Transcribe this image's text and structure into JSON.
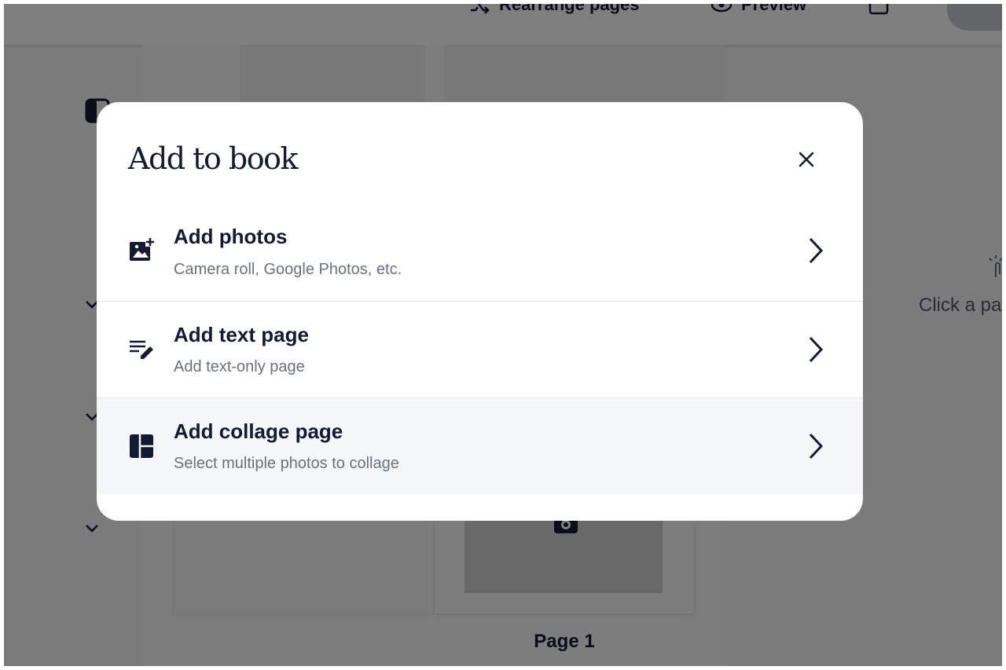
{
  "background": {
    "topbar": {
      "rearrange_label": "Rearrange pages",
      "preview_label": "Preview"
    },
    "page_label": "Page 1",
    "hint_text": "Click a pa"
  },
  "modal": {
    "title": "Add to book",
    "options": [
      {
        "title": "Add photos",
        "subtitle": "Camera roll, Google Photos, etc.",
        "icon": "add-photo-icon"
      },
      {
        "title": "Add text page",
        "subtitle": "Add text-only page",
        "icon": "edit-text-icon"
      },
      {
        "title": "Add collage page",
        "subtitle": "Select multiple photos to collage",
        "icon": "collage-icon"
      }
    ]
  },
  "colors": {
    "text_primary": "#141a33",
    "text_secondary": "#6b7180",
    "overlay": "rgba(0,0,0,0.5)",
    "highlight_row": "#f5f6f8"
  }
}
